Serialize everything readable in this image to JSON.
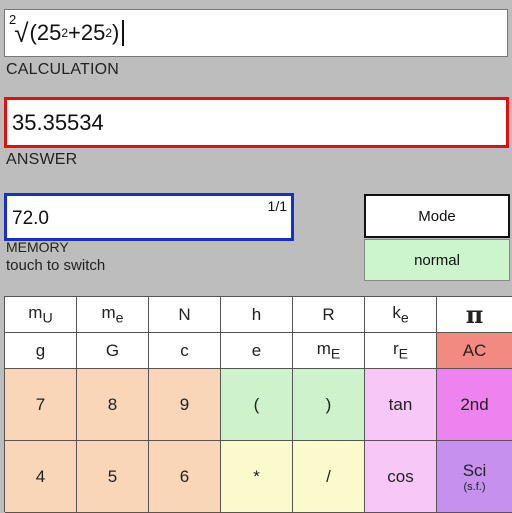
{
  "calculation": {
    "root_index": "2",
    "root_sign": "√",
    "open": "(25",
    "exp1": "2",
    "plus": "+25",
    "exp2": "2",
    "close": ")"
  },
  "labels": {
    "calculation": "CALCULATION",
    "answer": "ANSWER",
    "memory": "MEMORY",
    "memory_hint": "touch to switch"
  },
  "answer": {
    "value": "35.35534"
  },
  "memory": {
    "value": "72.0",
    "index": "1/1"
  },
  "mode": {
    "label": "Mode",
    "state": "normal"
  },
  "keys": {
    "row1": [
      {
        "main": "m",
        "sub": "U"
      },
      {
        "main": "m",
        "sub": "e"
      },
      {
        "main": "N"
      },
      {
        "main": "h"
      },
      {
        "main": "R"
      },
      {
        "main": "k",
        "sub": "e"
      },
      {
        "main": "π"
      }
    ],
    "row2": [
      {
        "main": "g"
      },
      {
        "main": "G"
      },
      {
        "main": "c"
      },
      {
        "main": "e"
      },
      {
        "main": "m",
        "sub": "E"
      },
      {
        "main": "r",
        "sub": "E"
      },
      {
        "main": "AC"
      }
    ],
    "row3": [
      "7",
      "8",
      "9",
      "(",
      ")",
      "tan",
      "2nd"
    ],
    "row4": [
      "4",
      "5",
      "6",
      "*",
      "/",
      "cos"
    ],
    "sci": {
      "main": "Sci",
      "sub": "(s.f.)"
    }
  },
  "colors": {
    "answer_border": "#e01010",
    "memory_border": "#1530d0",
    "normal_bg": "#ccf5cc"
  }
}
